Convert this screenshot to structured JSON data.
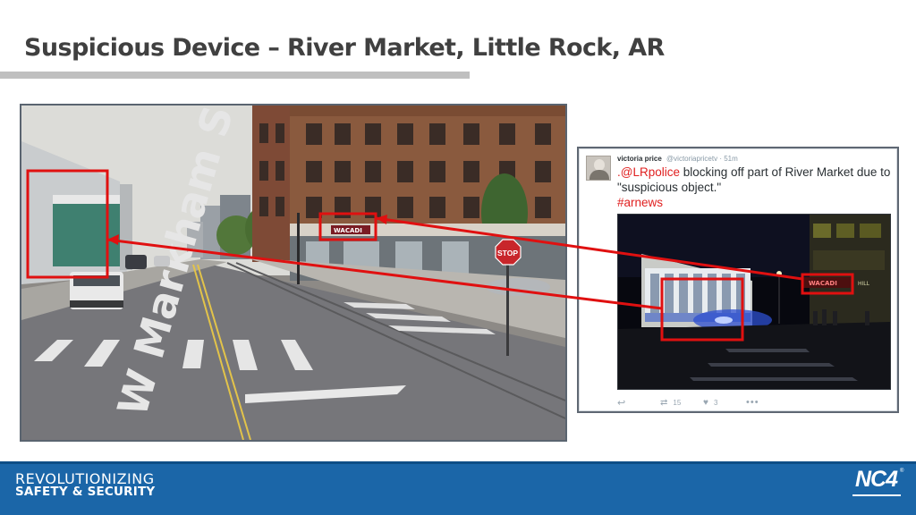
{
  "slide": {
    "title": "Suspicious Device – River Market, Little Rock, AR"
  },
  "street_photo": {
    "street_sign": "W Markham St",
    "stop_sign": "STOP",
    "storefront_sign": "WACADI"
  },
  "tweet": {
    "author": "victoria price",
    "handle": "@victoriapricetv",
    "age": "51m",
    "mention": ".@LRpolice",
    "text_body": " blocking off part of River Market due to \"suspicious object.\"",
    "hashtag": "#arnews",
    "photo_sign": "WACADI",
    "photo_sign_right": "HILL",
    "actions": {
      "reply_icon": "reply-icon",
      "retweet_icon": "retweet-icon",
      "retweet_count": "15",
      "like_icon": "heart-icon",
      "like_count": "3",
      "more_icon": "more-icon"
    }
  },
  "annotation": {
    "highlight_color": "#e01010"
  },
  "footer": {
    "tagline_line1": "REVOLUTIONIZING",
    "tagline_line2": "SAFETY & SECURITY",
    "logo_text": "NC4",
    "logo_tm": "®",
    "bar_color": "#1b66a8"
  }
}
